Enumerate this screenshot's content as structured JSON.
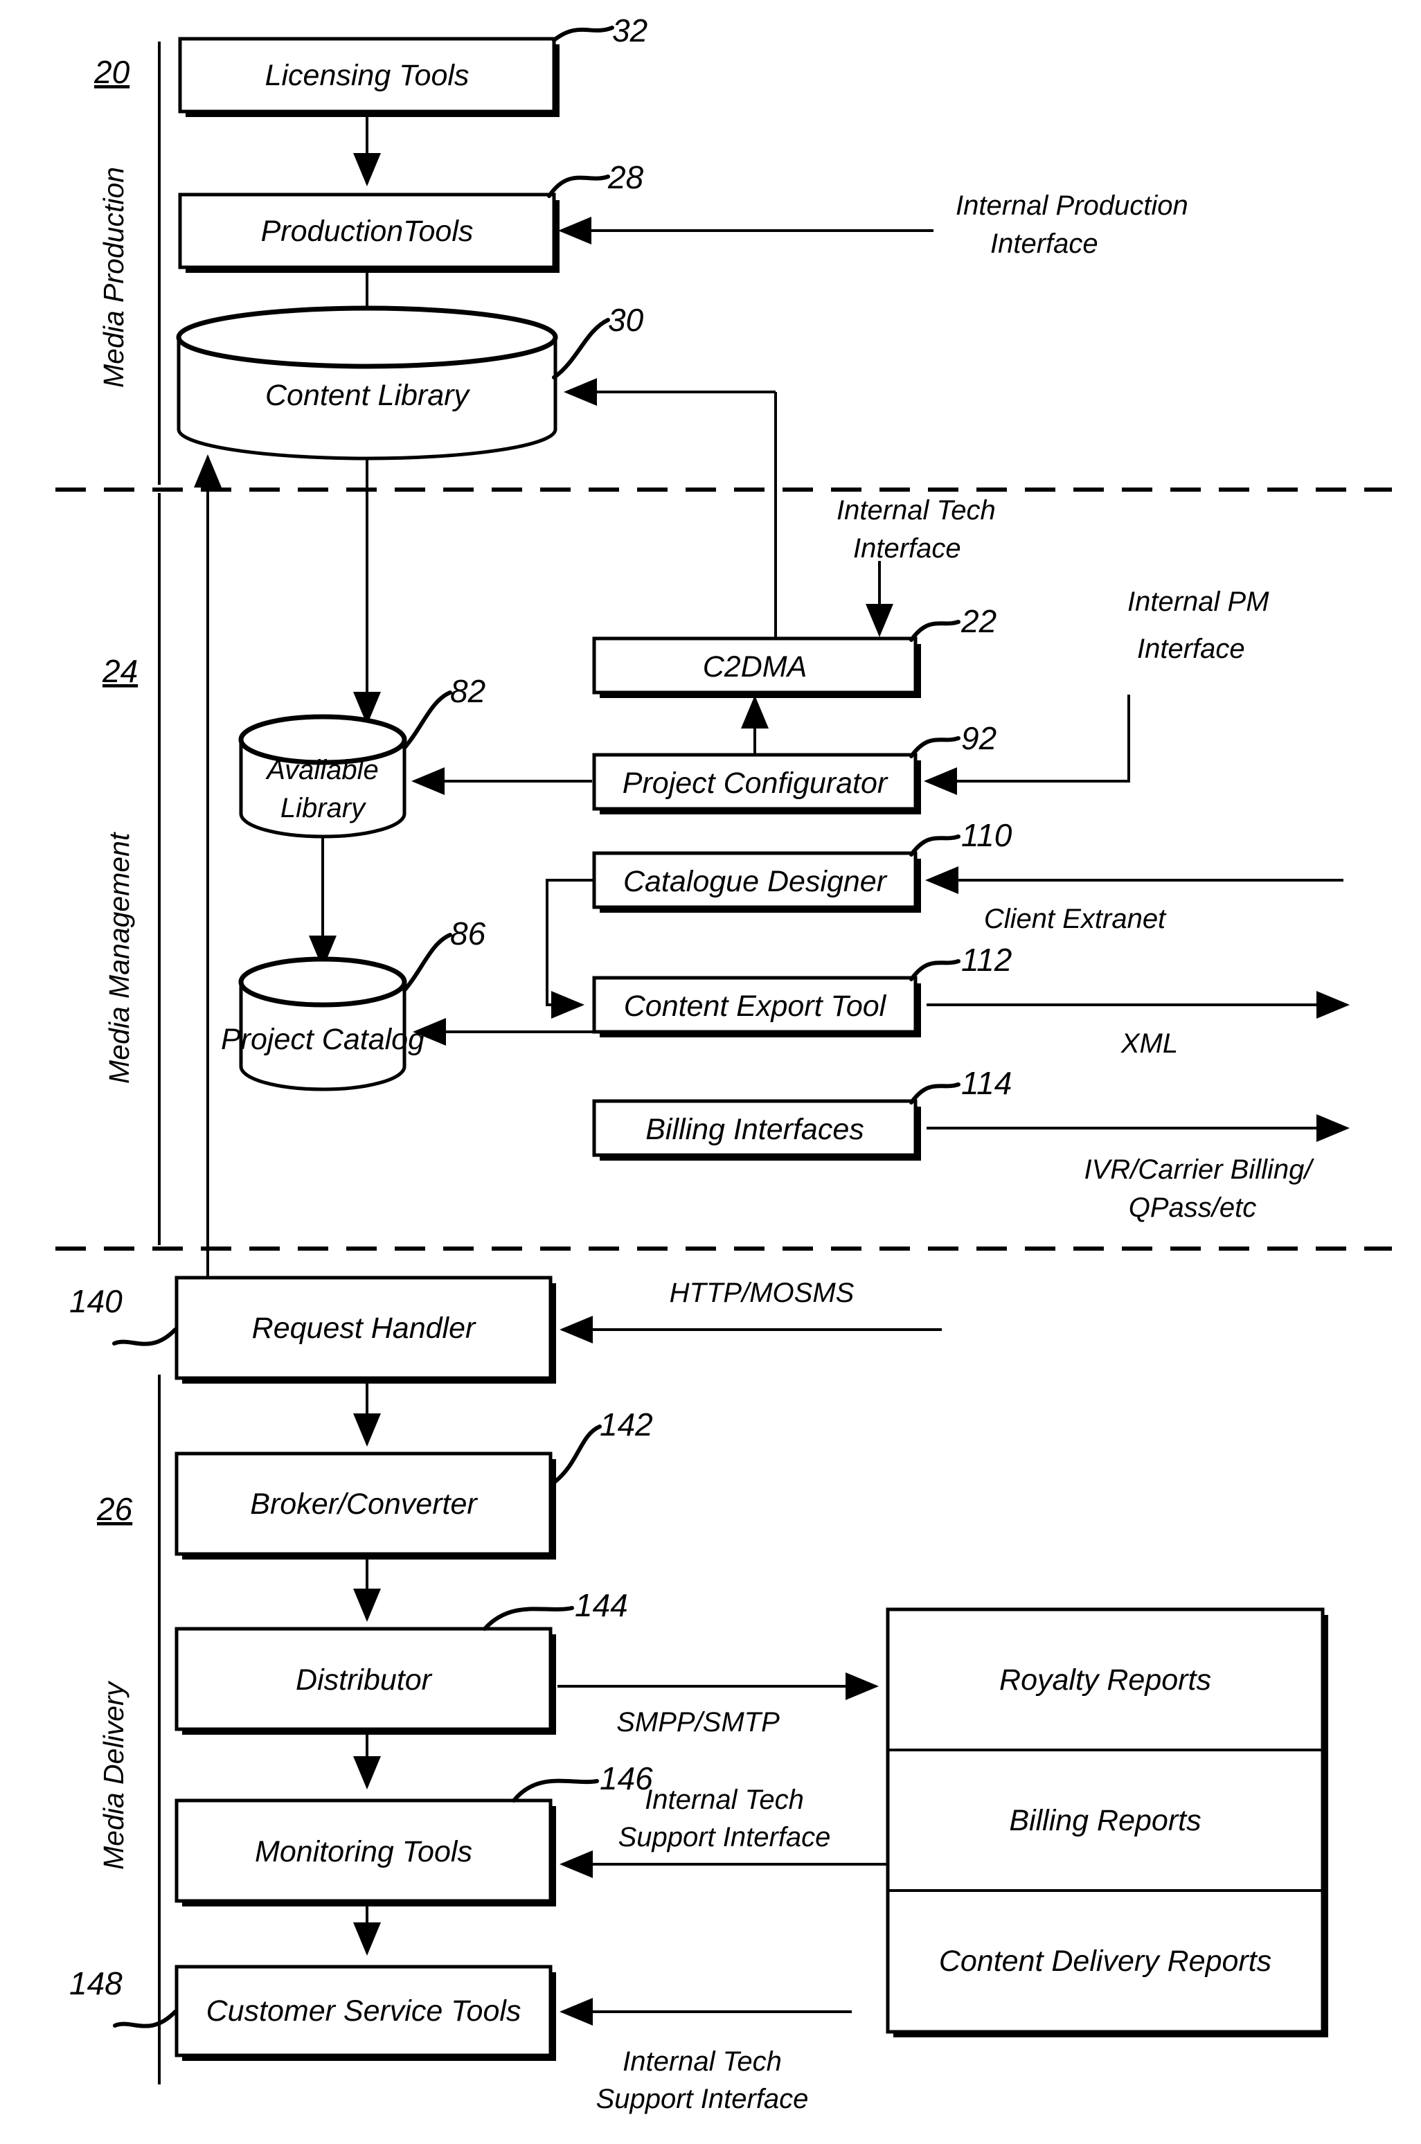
{
  "figure": {
    "type": "patent-block-diagram",
    "sections": [
      {
        "ref": "20",
        "label": "Media Production"
      },
      {
        "ref": "24",
        "label": "Media Management"
      },
      {
        "ref": "26",
        "label": "Media Delivery"
      }
    ]
  },
  "nodes": {
    "licensing_tools": {
      "label": "Licensing Tools",
      "ref": "32",
      "shape": "box"
    },
    "production_tools": {
      "label": "ProductionTools",
      "ref": "28",
      "shape": "box"
    },
    "content_library": {
      "label": "Content Library",
      "ref": "30",
      "shape": "cylinder"
    },
    "c2dma": {
      "label": "C2DMA",
      "ref": "22",
      "shape": "box"
    },
    "available_library": {
      "label_line1": "Available",
      "label_line2": "Library",
      "ref": "82",
      "shape": "cylinder"
    },
    "project_configurator": {
      "label": "Project Configurator",
      "ref": "92",
      "shape": "box"
    },
    "catalogue_designer": {
      "label": "Catalogue Designer",
      "ref": "110",
      "shape": "box"
    },
    "project_catalog": {
      "label": "Project Catalog",
      "ref": "86",
      "shape": "cylinder"
    },
    "content_export_tool": {
      "label": "Content Export Tool",
      "ref": "112",
      "shape": "box"
    },
    "billing_interfaces": {
      "label": "Billing Interfaces",
      "ref": "114",
      "shape": "box"
    },
    "request_handler": {
      "label": "Request Handler",
      "ref": "140",
      "shape": "box"
    },
    "broker_converter": {
      "label": "Broker/Converter",
      "ref": "142",
      "shape": "box"
    },
    "distributor": {
      "label": "Distributor",
      "ref": "144",
      "shape": "box"
    },
    "monitoring_tools": {
      "label": "Monitoring Tools",
      "ref": "146",
      "shape": "box"
    },
    "customer_service_tools": {
      "label": "Customer Service Tools",
      "ref": "148",
      "shape": "box"
    }
  },
  "reports_panel": {
    "rows": [
      "Royalty Reports",
      "Billing Reports",
      "Content Delivery Reports"
    ]
  },
  "annotations": {
    "internal_production_interface_l1": "Internal Production",
    "internal_production_interface_l2": "Interface",
    "internal_tech_interface_l1": "Internal Tech",
    "internal_tech_interface_l2": "Interface",
    "internal_pm_interface_l1": "Internal PM",
    "internal_pm_interface_l2": "Interface",
    "client_extranet": "Client Extranet",
    "xml": "XML",
    "ivr_billing_l1": "IVR/Carrier Billing/",
    "ivr_billing_l2": "QPass/etc",
    "http_mosms": "HTTP/MOSMS",
    "smpp_smtp": "SMPP/SMTP",
    "internal_tech_support_1_l1": "Internal Tech",
    "internal_tech_support_1_l2": "Support Interface",
    "internal_tech_support_2_l1": "Internal Tech",
    "internal_tech_support_2_l2": "Support Interface"
  },
  "section_labels": {
    "media_production": "Media Production",
    "media_management": "Media Management",
    "media_delivery": "Media Delivery"
  },
  "section_refs": {
    "production": "20",
    "management": "24",
    "delivery": "26"
  },
  "colors": {
    "ink": "#000000",
    "paper": "#ffffff"
  }
}
